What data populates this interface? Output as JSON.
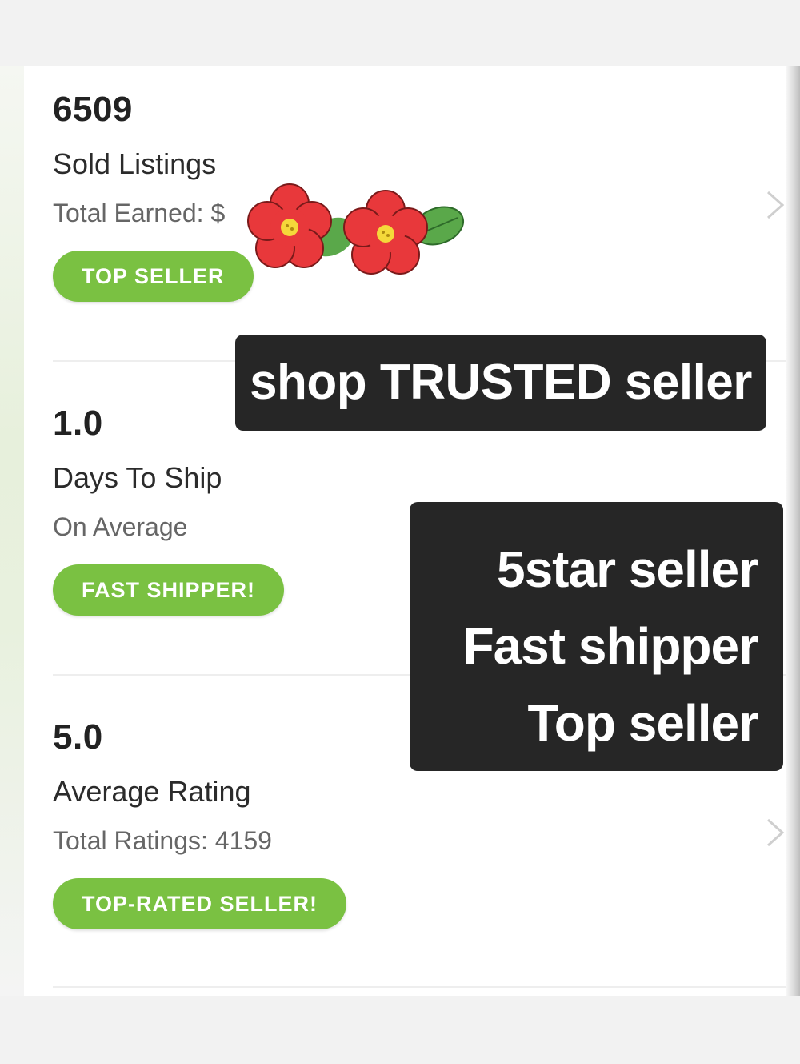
{
  "stats": [
    {
      "value": "6509",
      "label": "Sold Listings",
      "sub": "Total Earned: $",
      "badge": "TOP SELLER"
    },
    {
      "value": "1.0",
      "label": "Days To Ship",
      "sub": "On Average",
      "badge": "FAST SHIPPER!"
    },
    {
      "value": "5.0",
      "label": "Average Rating",
      "sub": "Total Ratings: 4159",
      "badge": "TOP-RATED SELLER!"
    }
  ],
  "overlays": {
    "trusted": "shop TRUSTED seller",
    "lines": [
      "5star seller",
      "Fast shipper",
      "Top seller"
    ]
  },
  "stickers": {
    "flowers_icon": "red-flowers-sticker"
  },
  "colors": {
    "badge_green": "#7ac142",
    "overlay_bg": "#262626",
    "flower_red": "#e8383b"
  }
}
